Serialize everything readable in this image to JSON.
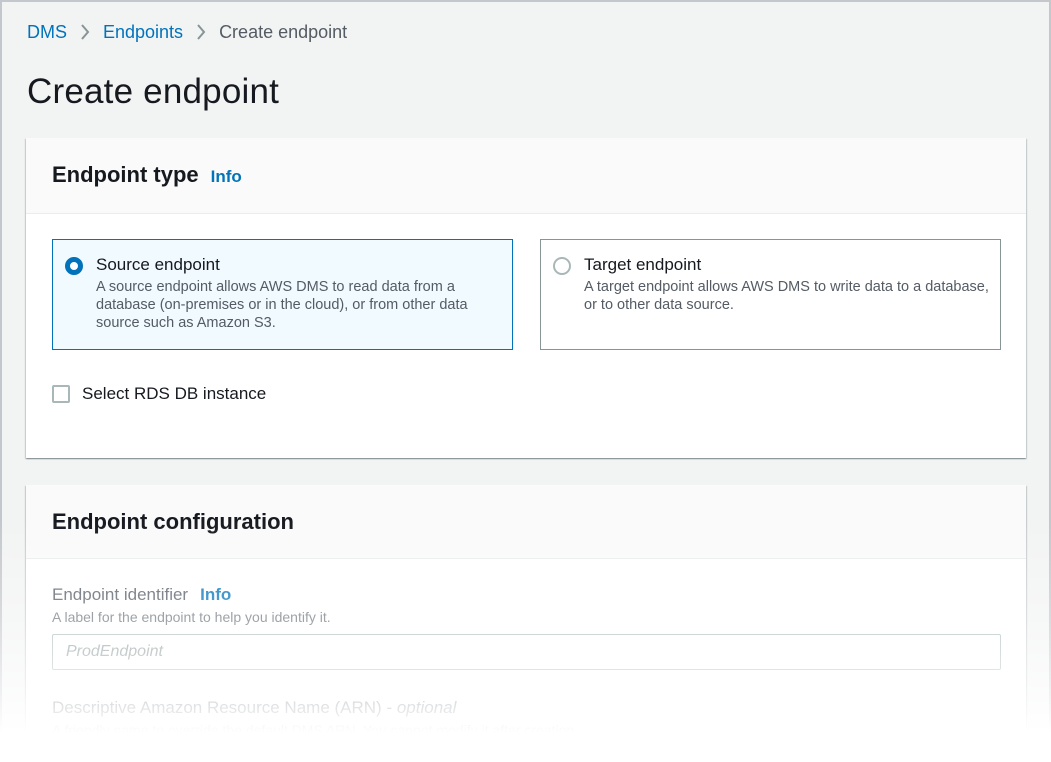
{
  "breadcrumb": {
    "items": [
      {
        "label": "DMS"
      },
      {
        "label": "Endpoints"
      },
      {
        "label": "Create endpoint"
      }
    ]
  },
  "page": {
    "title": "Create endpoint"
  },
  "endpoint_type_panel": {
    "title": "Endpoint type",
    "info_label": "Info",
    "options": [
      {
        "label": "Source endpoint",
        "description": "A source endpoint allows AWS DMS to read data from a database (on-premises or in the cloud), or from other data source such as Amazon S3.",
        "selected": true
      },
      {
        "label": "Target endpoint",
        "description": "A target endpoint allows AWS DMS to write data to a database, or to other data source.",
        "selected": false
      }
    ],
    "rds_checkbox": {
      "label": "Select RDS DB instance",
      "checked": false
    }
  },
  "endpoint_config_panel": {
    "title": "Endpoint configuration",
    "identifier": {
      "label": "Endpoint identifier",
      "info_label": "Info",
      "description": "A label for the endpoint to help you identify it.",
      "placeholder": "ProdEndpoint",
      "value": ""
    },
    "arn": {
      "label": "Descriptive Amazon Resource Name (ARN) - ",
      "optional_label": "optional",
      "description": "A friendly name to override the default DMS ARN. You cannot modify it after creation."
    }
  },
  "colors": {
    "accent": "#0073bb",
    "selected_tile_bg": "#f1faff",
    "page_bg": "#f2f3f3"
  }
}
